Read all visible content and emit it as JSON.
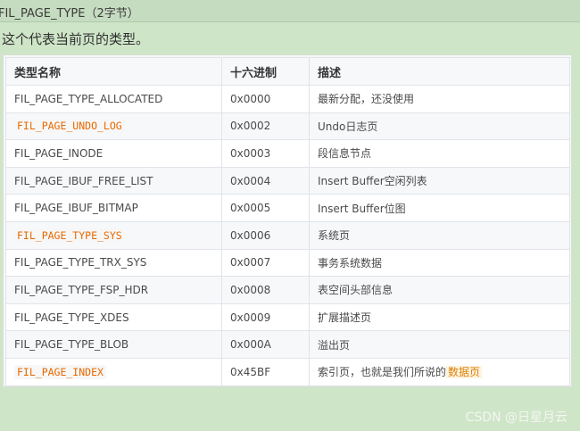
{
  "heading": "FIL_PAGE_TYPE（2字节）",
  "intro": "这个代表当前页的类型。",
  "table": {
    "headers": [
      "类型名称",
      "十六进制",
      "描述"
    ],
    "rows": [
      {
        "name": "FIL_PAGE_TYPE_ALLOCATED",
        "hex": "0x0000",
        "desc": "最新分配，还没使用",
        "highlight": false
      },
      {
        "name": "FIL_PAGE_UNDO_LOG",
        "hex": "0x0002",
        "desc": "Undo日志页",
        "highlight": true
      },
      {
        "name": "FIL_PAGE_INODE",
        "hex": "0x0003",
        "desc": "段信息节点",
        "highlight": false
      },
      {
        "name": "FIL_PAGE_IBUF_FREE_LIST",
        "hex": "0x0004",
        "desc": "Insert Buffer空闲列表",
        "highlight": false
      },
      {
        "name": "FIL_PAGE_IBUF_BITMAP",
        "hex": "0x0005",
        "desc": "Insert Buffer位图",
        "highlight": false
      },
      {
        "name": "FIL_PAGE_TYPE_SYS",
        "hex": "0x0006",
        "desc": "系统页",
        "highlight": true
      },
      {
        "name": "FIL_PAGE_TYPE_TRX_SYS",
        "hex": "0x0007",
        "desc": "事务系统数据",
        "highlight": false
      },
      {
        "name": "FIL_PAGE_TYPE_FSP_HDR",
        "hex": "0x0008",
        "desc": "表空间头部信息",
        "highlight": false
      },
      {
        "name": "FIL_PAGE_TYPE_XDES",
        "hex": "0x0009",
        "desc": "扩展描述页",
        "highlight": false
      },
      {
        "name": "FIL_PAGE_TYPE_BLOB",
        "hex": "0x000A",
        "desc": "溢出页",
        "highlight": false
      },
      {
        "name": "FIL_PAGE_INDEX",
        "hex": "0x45BF",
        "desc": "索引页，也就是我们所说的",
        "highlight": true,
        "desc_link": "数据页"
      }
    ]
  },
  "watermark": "CSDN @日星月云",
  "colors": {
    "background": "#cfe5c8",
    "code_highlight": "#e96900",
    "link": "#d9820b"
  }
}
